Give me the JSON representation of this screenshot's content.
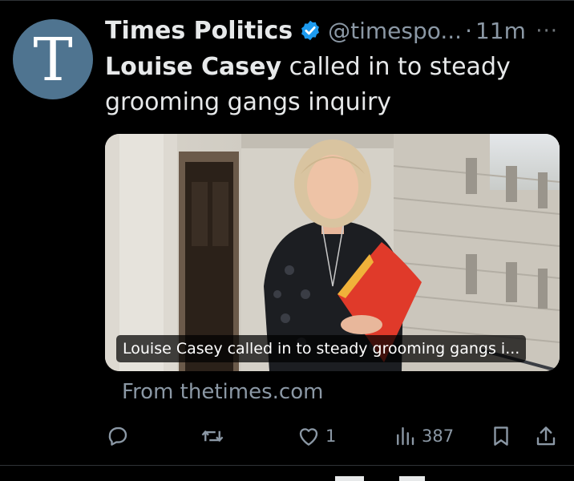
{
  "tweet": {
    "avatar_letter": "T",
    "author_name": "Times Politics",
    "handle": "@timespo...",
    "separator": "·",
    "time": "11m",
    "more": "···",
    "text_bold": "Louise Casey",
    "text_rest": " called in to steady grooming gangs inquiry",
    "card": {
      "caption": "Louise Casey called in to steady grooming gangs i..."
    },
    "domain": "From thetimes.com",
    "actions": {
      "reply_icon": "reply-icon",
      "retweet_icon": "retweet-icon",
      "like_icon": "heart-icon",
      "like_count": "1",
      "views_icon": "views-icon",
      "views_count": "387",
      "bookmark_icon": "bookmark-icon",
      "share_icon": "share-icon"
    }
  },
  "colors": {
    "background": "#000000",
    "text": "#e7e9ea",
    "secondary": "#8b98a5",
    "verified": "#1d9bf0",
    "avatar": "#4f7490"
  }
}
